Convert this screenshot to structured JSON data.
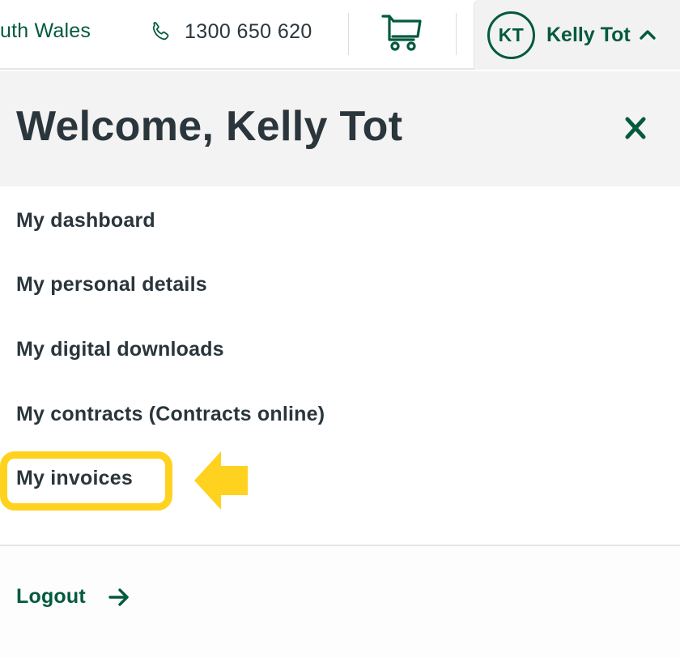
{
  "header": {
    "region_label": "uth Wales",
    "phone": {
      "icon": "phone-icon",
      "number": "1300 650 620"
    },
    "cart": {
      "icon": "cart-icon"
    },
    "user": {
      "initials": "KT",
      "name": "Kelly Tot",
      "toggle_icon": "chevron-up-icon",
      "expanded": true
    }
  },
  "account_panel": {
    "title": "Welcome, Kelly Tot",
    "close_icon": "close-icon",
    "menu_items": [
      {
        "label": "My dashboard"
      },
      {
        "label": "My personal details"
      },
      {
        "label": "My digital downloads"
      },
      {
        "label": "My contracts (Contracts online)"
      },
      {
        "label": "My invoices",
        "highlighted": true
      }
    ],
    "logout": {
      "label": "Logout",
      "icon": "arrow-right-icon"
    }
  },
  "annotation": {
    "highlight_target": "My invoices",
    "pointer_icon": "arrow-left-icon"
  },
  "colors": {
    "brand_green": "#035a3c",
    "text_dark": "#2a353c",
    "highlight_yellow": "#ffd21f",
    "panel_gray": "#f3f3f3"
  }
}
